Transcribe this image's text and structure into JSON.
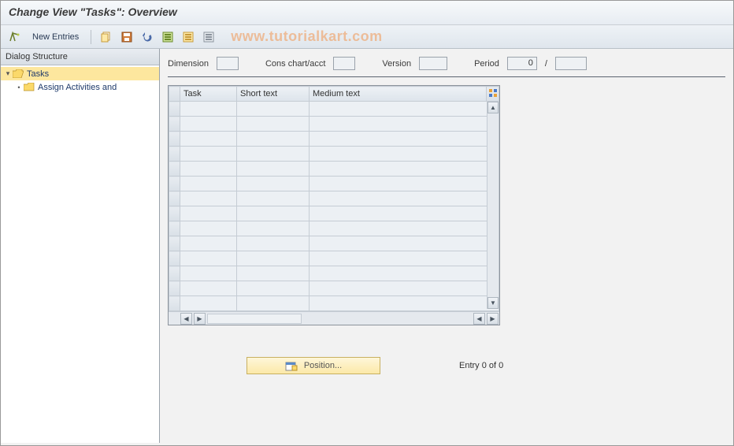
{
  "title": "Change View \"Tasks\": Overview",
  "toolbar": {
    "new_entries": "New Entries"
  },
  "watermark": "www.tutorialkart.com",
  "sidebar": {
    "header": "Dialog Structure",
    "items": [
      {
        "label": "Tasks",
        "level": 0,
        "open": true,
        "selected": true
      },
      {
        "label": "Assign Activities and",
        "level": 1,
        "open": false,
        "selected": false
      }
    ]
  },
  "header_fields": {
    "dimension_label": "Dimension",
    "dimension_value": "",
    "cons_label": "Cons chart/acct",
    "cons_value": "",
    "version_label": "Version",
    "version_value": "",
    "period_label": "Period",
    "period_value": "0",
    "period_sep": "/",
    "period_year": ""
  },
  "table": {
    "columns": [
      "Task",
      "Short text",
      "Medium text"
    ],
    "row_count": 14
  },
  "footer": {
    "position_btn": "Position...",
    "entry_text": "Entry 0 of 0"
  }
}
